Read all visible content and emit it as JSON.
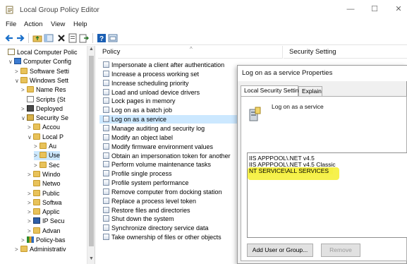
{
  "window": {
    "title": "Local Group Policy Editor",
    "minimize": "—",
    "maximize": "☐",
    "close": "✕"
  },
  "menu": [
    "File",
    "Action",
    "View",
    "Help"
  ],
  "tree": [
    {
      "label": "Local Computer Polic",
      "indent": 0,
      "chev": "",
      "icon": "computer-policy",
      "sel": false
    },
    {
      "label": "Computer Config",
      "indent": 1,
      "chev": "∨",
      "icon": "computer",
      "sel": false
    },
    {
      "label": "Software Setti",
      "indent": 2,
      "chev": ">",
      "icon": "folder",
      "sel": false
    },
    {
      "label": "Windows Sett",
      "indent": 2,
      "chev": "∨",
      "icon": "folder",
      "sel": false
    },
    {
      "label": "Name Res",
      "indent": 3,
      "chev": ">",
      "icon": "folder",
      "sel": false
    },
    {
      "label": "Scripts (St",
      "indent": 3,
      "chev": "",
      "icon": "script",
      "sel": false
    },
    {
      "label": "Deployed",
      "indent": 3,
      "chev": ">",
      "icon": "printer",
      "sel": false
    },
    {
      "label": "Security Se",
      "indent": 3,
      "chev": "∨",
      "icon": "security",
      "sel": false
    },
    {
      "label": "Accou",
      "indent": 4,
      "chev": ">",
      "icon": "folder",
      "sel": false
    },
    {
      "label": "Local P",
      "indent": 4,
      "chev": "∨",
      "icon": "folder",
      "sel": false
    },
    {
      "label": "Au",
      "indent": 5,
      "chev": ">",
      "icon": "folder",
      "sel": false
    },
    {
      "label": "Use",
      "indent": 5,
      "chev": ">",
      "icon": "folder",
      "sel": true
    },
    {
      "label": "Sec",
      "indent": 5,
      "chev": ">",
      "icon": "folder",
      "sel": false
    },
    {
      "label": "Windo",
      "indent": 4,
      "chev": ">",
      "icon": "folder",
      "sel": false
    },
    {
      "label": "Netwo",
      "indent": 4,
      "chev": "",
      "icon": "folder",
      "sel": false
    },
    {
      "label": "Public",
      "indent": 4,
      "chev": ">",
      "icon": "folder",
      "sel": false
    },
    {
      "label": "Softwa",
      "indent": 4,
      "chev": ">",
      "icon": "folder",
      "sel": false
    },
    {
      "label": "Applic",
      "indent": 4,
      "chev": ">",
      "icon": "folder",
      "sel": false
    },
    {
      "label": "IP Secu",
      "indent": 4,
      "chev": ">",
      "icon": "ipsec",
      "sel": false
    },
    {
      "label": "Advan",
      "indent": 4,
      "chev": ">",
      "icon": "folder",
      "sel": false
    },
    {
      "label": "Policy-bas",
      "indent": 3,
      "chev": ">",
      "icon": "chart",
      "sel": false
    },
    {
      "label": "Administrativ",
      "indent": 2,
      "chev": ">",
      "icon": "folder",
      "sel": false
    }
  ],
  "list": {
    "col_policy": "Policy",
    "col_setting": "Security Setting",
    "sort_arrow": "^",
    "rows": [
      {
        "label": "Impersonate a client after authentication",
        "sel": false
      },
      {
        "label": "Increase a process working set",
        "sel": false
      },
      {
        "label": "Increase scheduling priority",
        "sel": false
      },
      {
        "label": "Load and unload device drivers",
        "sel": false
      },
      {
        "label": "Lock pages in memory",
        "sel": false
      },
      {
        "label": "Log on as a batch job",
        "sel": false
      },
      {
        "label": "Log on as a service",
        "sel": true
      },
      {
        "label": "Manage auditing and security log",
        "sel": false
      },
      {
        "label": "Modify an object label",
        "sel": false
      },
      {
        "label": "Modify firmware environment values",
        "sel": false
      },
      {
        "label": "Obtain an impersonation token for another",
        "sel": false
      },
      {
        "label": "Perform volume maintenance tasks",
        "sel": false
      },
      {
        "label": "Profile single process",
        "sel": false
      },
      {
        "label": "Profile system performance",
        "sel": false
      },
      {
        "label": "Remove computer from docking station",
        "sel": false
      },
      {
        "label": "Replace a process level token",
        "sel": false
      },
      {
        "label": "Restore files and directories",
        "sel": false
      },
      {
        "label": "Shut down the system",
        "sel": false
      },
      {
        "label": "Synchronize directory service data",
        "sel": false
      },
      {
        "label": "Take ownership of files or other objects",
        "sel": false
      }
    ]
  },
  "dialog": {
    "title": "Log on as a service Properties",
    "tab_local": "Local Security Setting",
    "tab_explain": "Explain",
    "policy_name": "Log on as a service",
    "accounts": [
      {
        "label": "IIS APPPOOL\\.NET v4.5",
        "hl": false
      },
      {
        "label": "IIS APPPOOL\\.NET v4.5 Classic",
        "hl": false
      },
      {
        "label": "NT SERVICE\\ALL SERVICES",
        "hl": true
      }
    ],
    "add_button": "Add User or Group...",
    "remove_button": "Remove"
  },
  "colors": {
    "selection": "#cce8ff",
    "highlight": "#f5f043",
    "folder": "#e8c25a"
  }
}
